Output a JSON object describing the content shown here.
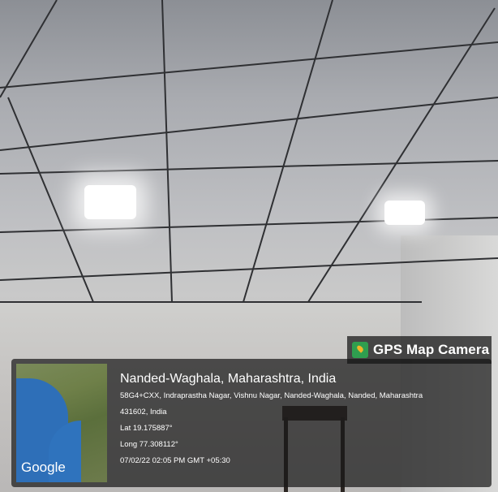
{
  "watermark": {
    "label": "GPS Map Camera",
    "icon": "gps-map-camera-icon"
  },
  "map": {
    "brand": "Google"
  },
  "location": {
    "title": "Nanded-Waghala, Maharashtra, India",
    "address_line1": "58G4+CXX, Indraprastha Nagar, Vishnu Nagar, Nanded-Waghala, Nanded, Maharashtra",
    "address_line2": "431602, India",
    "lat": "Lat 19.175887°",
    "long": "Long 77.308112°",
    "timestamp": "07/02/22 02:05 PM GMT +05:30"
  }
}
